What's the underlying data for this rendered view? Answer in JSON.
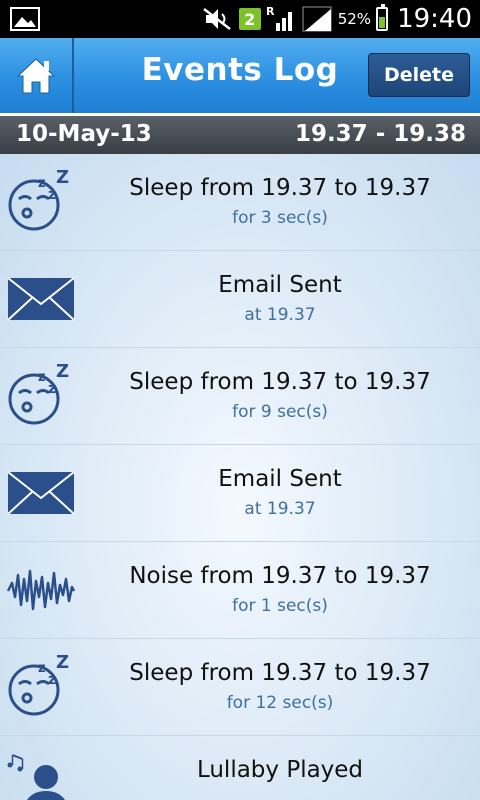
{
  "statusbar": {
    "network_badge": "2",
    "roaming_label": "R",
    "battery_percent": "52%",
    "time": "19:40",
    "icons": [
      "gallery-icon",
      "muted-icon",
      "signal-icon",
      "roaming-signal-icon",
      "battery-icon"
    ]
  },
  "header": {
    "title": "Events Log",
    "delete_label": "Delete",
    "home_icon": "home-icon"
  },
  "datebar": {
    "date": "10-May-13",
    "range": "19.37 - 19.38"
  },
  "events": [
    {
      "type": "sleep",
      "icon": "sleep-face-icon",
      "main": "Sleep from 19.37 to 19.37",
      "sub": "for 3 sec(s)"
    },
    {
      "type": "email",
      "icon": "envelope-icon",
      "main": "Email Sent",
      "sub": "at 19.37"
    },
    {
      "type": "sleep",
      "icon": "sleep-face-icon",
      "main": "Sleep from 19.37 to 19.37",
      "sub": "for 9 sec(s)"
    },
    {
      "type": "email",
      "icon": "envelope-icon",
      "main": "Email Sent",
      "sub": "at 19.37"
    },
    {
      "type": "noise",
      "icon": "noise-wave-icon",
      "main": "Noise from 19.37 to 19.37",
      "sub": "for 1 sec(s)"
    },
    {
      "type": "sleep",
      "icon": "sleep-face-icon",
      "main": "Sleep from 19.37 to 19.37",
      "sub": "for 12 sec(s)"
    },
    {
      "type": "lullaby",
      "icon": "lullaby-icon",
      "main": "Lullaby Played",
      "sub": ""
    }
  ],
  "colors": {
    "header_blue": "#2c8fe0",
    "delete_button": "#1d4677",
    "icon_blue": "#2a4f8a",
    "sub_text": "#3f6f9e"
  }
}
